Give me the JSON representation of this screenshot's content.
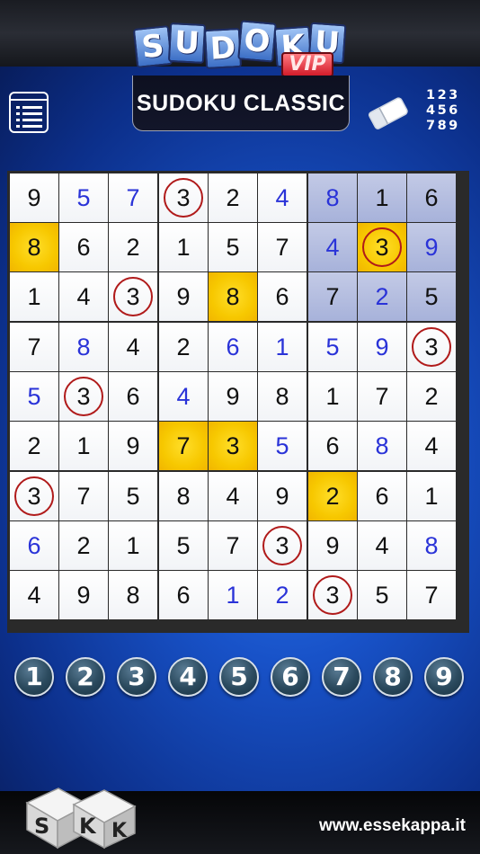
{
  "app": {
    "logo_letters": [
      "S",
      "U",
      "D",
      "O",
      "K",
      "U"
    ],
    "logo_badge": "VIP",
    "title": "SUDOKU CLASSIC",
    "number_hint_rows": [
      "123",
      "456",
      "789"
    ],
    "website": "www.essekappa.it",
    "dice_letters": [
      "S",
      "K",
      "K"
    ]
  },
  "colors": {
    "given_digit": "#111111",
    "user_digit": "#2a33d8",
    "highlight_gold": "#f7c800",
    "highlight_blue": "#b3bce0",
    "circle": "#b01a1a"
  },
  "board": {
    "rows": [
      [
        9,
        5,
        7,
        3,
        2,
        4,
        8,
        1,
        6
      ],
      [
        8,
        6,
        2,
        1,
        5,
        7,
        4,
        3,
        9
      ],
      [
        1,
        4,
        3,
        9,
        8,
        6,
        7,
        2,
        5
      ],
      [
        7,
        8,
        4,
        2,
        6,
        1,
        5,
        9,
        3
      ],
      [
        5,
        3,
        6,
        4,
        9,
        8,
        1,
        7,
        2
      ],
      [
        2,
        1,
        9,
        7,
        3,
        5,
        6,
        8,
        4
      ],
      [
        3,
        7,
        5,
        8,
        4,
        9,
        2,
        6,
        1
      ],
      [
        6,
        2,
        1,
        5,
        7,
        3,
        9,
        4,
        8
      ],
      [
        4,
        9,
        8,
        6,
        1,
        2,
        3,
        5,
        7
      ]
    ],
    "user_entered": [
      [
        0,
        1
      ],
      [
        0,
        2
      ],
      [
        0,
        5
      ],
      [
        0,
        6
      ],
      [
        1,
        6
      ],
      [
        1,
        8
      ],
      [
        2,
        7
      ],
      [
        3,
        1
      ],
      [
        3,
        4
      ],
      [
        3,
        5
      ],
      [
        3,
        6
      ],
      [
        3,
        7
      ],
      [
        4,
        0
      ],
      [
        4,
        3
      ],
      [
        5,
        5
      ],
      [
        5,
        7
      ],
      [
        7,
        0
      ],
      [
        7,
        8
      ],
      [
        8,
        4
      ],
      [
        8,
        5
      ]
    ],
    "circled": [
      [
        0,
        3
      ],
      [
        1,
        7
      ],
      [
        2,
        2
      ],
      [
        3,
        8
      ],
      [
        4,
        1
      ],
      [
        6,
        0
      ],
      [
        7,
        5
      ],
      [
        8,
        6
      ]
    ],
    "highlight_gold": [
      [
        1,
        0
      ],
      [
        1,
        7
      ],
      [
        2,
        4
      ],
      [
        5,
        3
      ],
      [
        5,
        4
      ],
      [
        6,
        6
      ]
    ],
    "highlight_blue": [
      [
        0,
        6
      ],
      [
        0,
        7
      ],
      [
        0,
        8
      ],
      [
        1,
        6
      ],
      [
        1,
        8
      ],
      [
        2,
        6
      ],
      [
        2,
        7
      ],
      [
        2,
        8
      ]
    ]
  },
  "number_picker": [
    "1",
    "2",
    "3",
    "4",
    "5",
    "6",
    "7",
    "8",
    "9"
  ]
}
